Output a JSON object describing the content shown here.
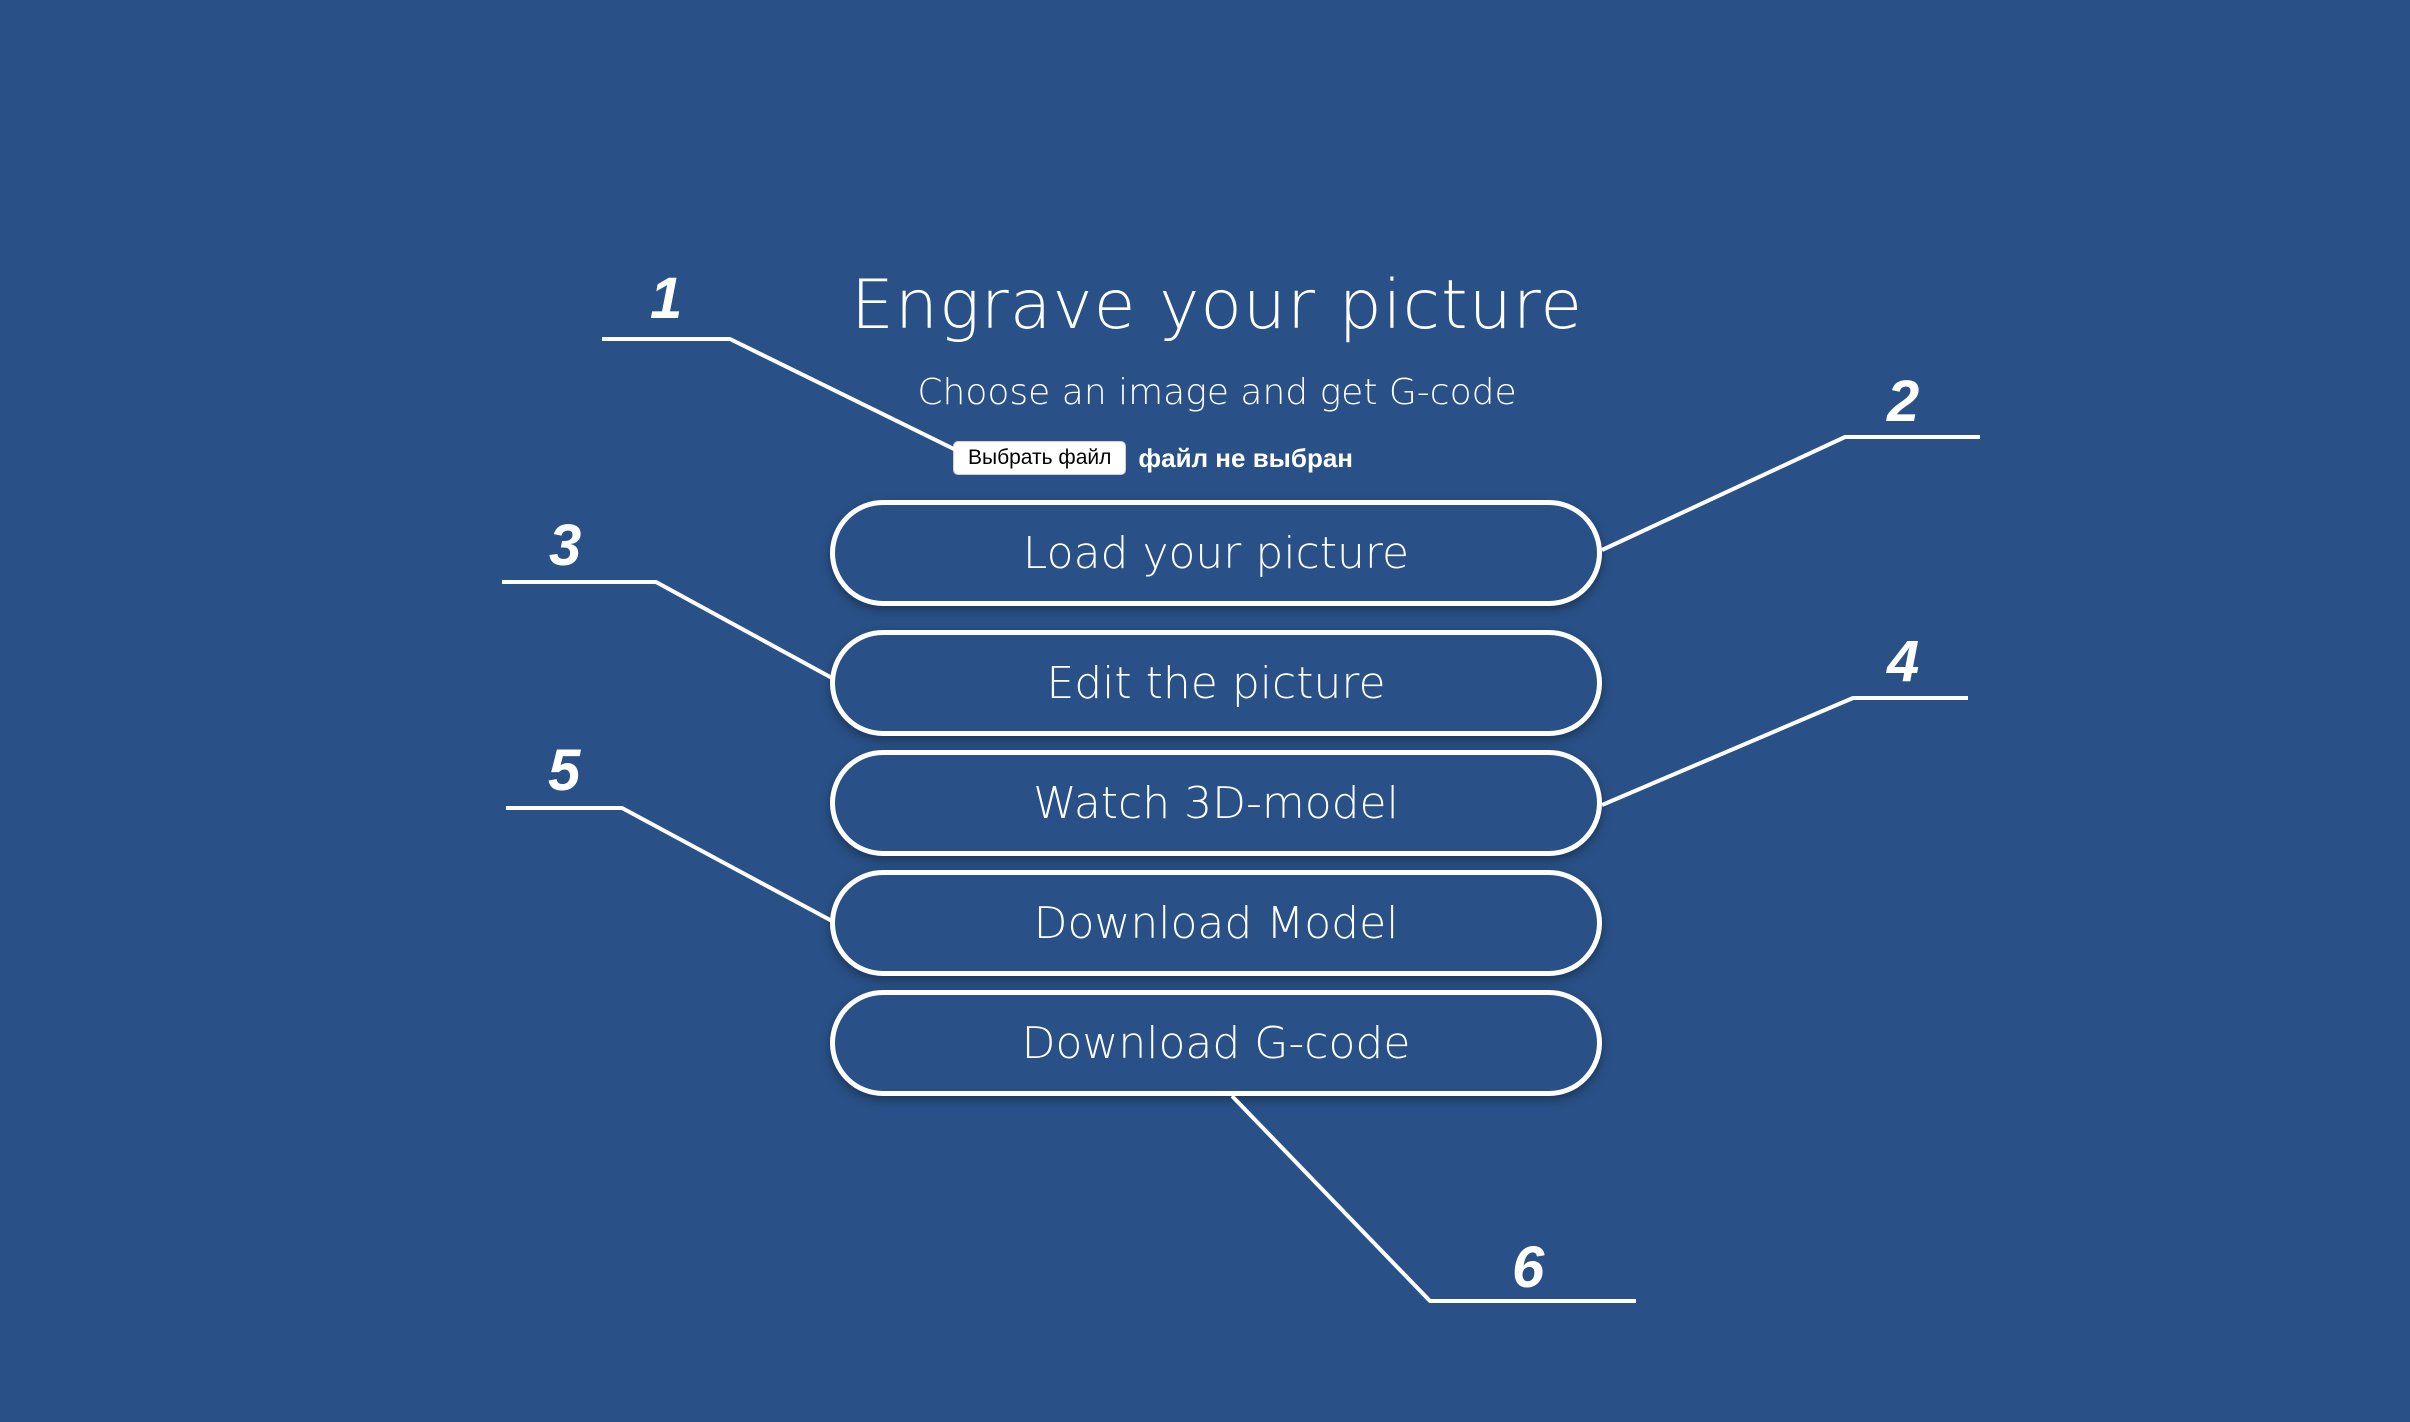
{
  "page": {
    "title": "Engrave your picture",
    "subtitle": "Choose an image and get G-code"
  },
  "file_input": {
    "button_label": "Выбрать файл",
    "status": "файл не выбран"
  },
  "menu": {
    "items": [
      {
        "label": "Load your picture"
      },
      {
        "label": "Edit the picture"
      },
      {
        "label": "Watch 3D-model"
      },
      {
        "label": "Download Model"
      },
      {
        "label": "Download G-code"
      }
    ]
  },
  "callouts": [
    "1",
    "2",
    "3",
    "4",
    "5",
    "6"
  ],
  "colors": {
    "background": "#295187",
    "foreground": "#ffffff"
  }
}
